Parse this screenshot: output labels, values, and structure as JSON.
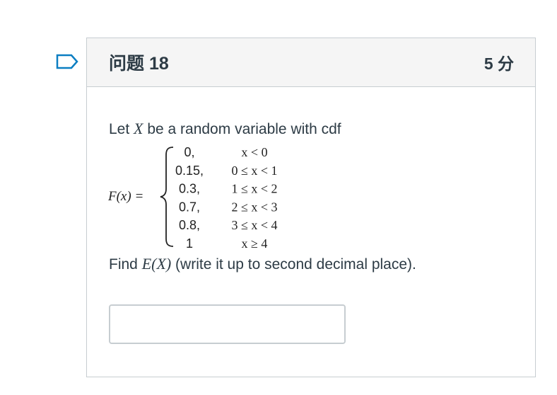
{
  "question": {
    "title": "问题 18",
    "points": "5 分",
    "prompt_before": "Let ",
    "prompt_var": "X",
    "prompt_after": " be a random variable with cdf",
    "function_label": "F(x) =",
    "cdf_rows": [
      {
        "value": "0,",
        "condition": "x < 0"
      },
      {
        "value": "0.15,",
        "condition": "0 ≤ x < 1"
      },
      {
        "value": "0.3,",
        "condition": "1 ≤ x < 2"
      },
      {
        "value": "0.7,",
        "condition": "2 ≤ x < 3"
      },
      {
        "value": "0.8,",
        "condition": "3 ≤ x < 4"
      },
      {
        "value": "1",
        "condition": "x ≥ 4"
      }
    ],
    "find_before": "Find ",
    "find_expr": "E(X)",
    "find_after": " (write it up to second decimal place).",
    "answer_value": ""
  },
  "icons": {
    "flag": "flag-question-icon"
  },
  "colors": {
    "header_bg": "#f5f5f5",
    "border": "#c7cdd1",
    "text": "#2d3b45",
    "flag": "#0b7ec2"
  }
}
